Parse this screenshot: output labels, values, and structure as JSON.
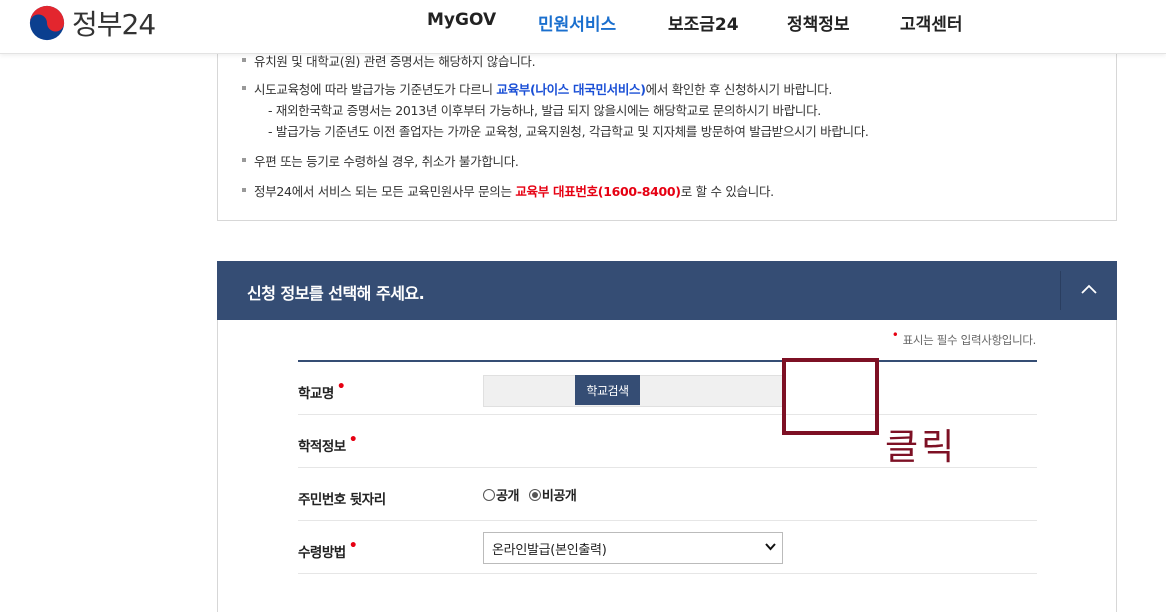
{
  "header": {
    "logo_text": "정부24",
    "nav": [
      "MyGOV",
      "민원서비스",
      "보조금24",
      "정책정보",
      "고객센터"
    ],
    "active_nav": "민원서비스"
  },
  "notice": {
    "line0": "유치원 및 대학교(원) 관련 증명서는 해당하지 않습니다.",
    "line1_pre": "시도교육청에 따라 발급가능 기준년도가 다르니 ",
    "line1_link": "교육부(나이스 대국민서비스)",
    "line1_post": "에서 확인한 후 신청하시기 바랍니다.",
    "line1_sub1": "- 재외한국학교 증명서는 2013년 이후부터 가능하나, 발급 되지 않을시에는 해당학교로 문의하시기 바랍니다.",
    "line1_sub2": "- 발급가능 기준년도 이전 졸업자는 가까운 교육청, 교육지원청, 각급학교 및 지자체를 방문하여 발급받으시기 바랍니다.",
    "line2": "우편 또는 등기로 수령하실 경우, 취소가 불가합니다.",
    "line3_pre": "정부24에서 서비스 되는 모든 교육민원사무 문의는 ",
    "line3_hl": "교육부 대표번호(1600-8400)",
    "line3_post": "로 할 수 있습니다."
  },
  "section": {
    "title": "신청 정보를 선택해 주세요.",
    "required_note_mark": "•",
    "required_note": "표시는 필수 입력사항입니다."
  },
  "form": {
    "school_label": "학교명",
    "school_search_button": "학교검색",
    "school_value": "",
    "record_label": "학적정보",
    "ssn_label": "주민번호 뒷자리",
    "ssn_options": [
      "공개",
      "비공개"
    ],
    "ssn_selected": "비공개",
    "receive_label": "수령방법",
    "receive_selected": "온라인발급(본인출력)"
  },
  "annotation": {
    "text": "클릭",
    "color": "#7d1024"
  },
  "colors": {
    "section_bg": "#354d74",
    "active_nav": "#1a6fce",
    "highlight_blue": "#1a4fd6",
    "highlight_red": "#e60012"
  }
}
